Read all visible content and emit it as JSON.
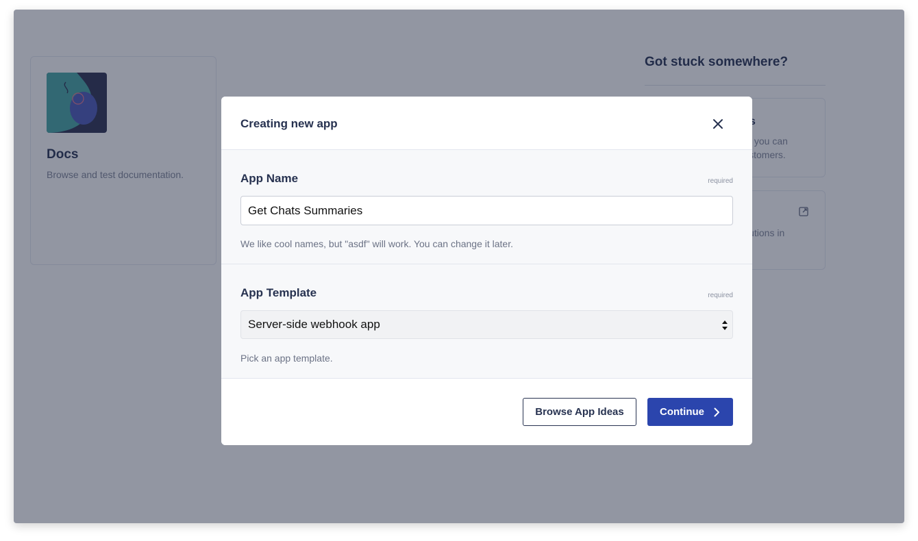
{
  "background": {
    "card": {
      "title": "Docs",
      "description": "Browse and test documentation."
    },
    "help": {
      "title": "Got stuck somewhere?",
      "card1_title_fragment": "s",
      "card1_line1_fragment": "s you can",
      "card1_line2_fragment": "istomers.",
      "card2_line1_fragment": "lutions in"
    }
  },
  "modal": {
    "title": "Creating new app",
    "app_name": {
      "label": "App Name",
      "required": "required",
      "value": "Get Chats Summaries",
      "help": "We like cool names, but \"asdf\" will work. You can change it later."
    },
    "app_template": {
      "label": "App Template",
      "required": "required",
      "selected": "Server-side webhook app",
      "help": "Pick an app template."
    },
    "footer": {
      "browse_label": "Browse App Ideas",
      "continue_label": "Continue"
    }
  },
  "colors": {
    "primary": "#2b45ad",
    "text_dark": "#273250",
    "overlay": "rgba(38,45,70,0.5)"
  }
}
